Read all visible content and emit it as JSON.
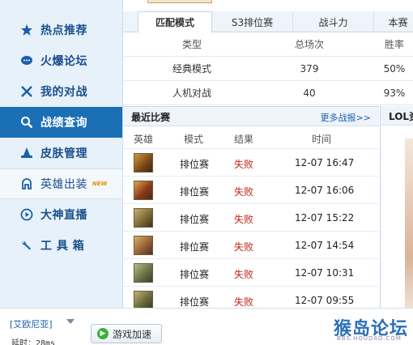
{
  "sidebar": {
    "items": [
      {
        "label": "热点推荐",
        "icon": "star-icon"
      },
      {
        "label": "火爆论坛",
        "icon": "chat-icon"
      },
      {
        "label": "我的对战",
        "icon": "crossed-swords-icon"
      },
      {
        "label": "战绩查询",
        "icon": "search-icon"
      },
      {
        "label": "皮肤管理",
        "icon": "wizard-hat-icon"
      },
      {
        "label": "英雄出装",
        "icon": "helmet-icon",
        "badge": "NEW"
      },
      {
        "label": "大神直播",
        "icon": "play-icon"
      },
      {
        "label": "工 具 箱",
        "icon": "wrench-icon"
      }
    ],
    "active_label": "战绩查询"
  },
  "tabs": [
    "匹配模式",
    "S3排位赛",
    "战斗力",
    "本赛"
  ],
  "stats_table": {
    "headers": [
      "类型",
      "总场次",
      "胜率"
    ],
    "rows": [
      [
        "经典模式",
        "379",
        "50%"
      ],
      [
        "人机对战",
        "40",
        "93%"
      ]
    ]
  },
  "recent": {
    "title": "最近比赛",
    "more_link": "更多战报>>",
    "headers": [
      "英雄",
      "模式",
      "结果",
      "时间"
    ],
    "rows": [
      {
        "mode": "排位赛",
        "result": "失败",
        "time": "12-07 16:47"
      },
      {
        "mode": "排位赛",
        "result": "失败",
        "time": "12-07 16:06"
      },
      {
        "mode": "排位赛",
        "result": "失败",
        "time": "12-07 15:22"
      },
      {
        "mode": "排位赛",
        "result": "失败",
        "time": "12-07 14:54"
      },
      {
        "mode": "排位赛",
        "result": "失败",
        "time": "12-07 10:31"
      },
      {
        "mode": "排位赛",
        "result": "失败",
        "time": "12-07 09:55"
      }
    ]
  },
  "side_panel": {
    "title": "LOL资"
  },
  "bottom": {
    "server": "[艾欧尼亚]",
    "latency": "延时：28ms",
    "accel_button": "游戏加速",
    "watermark": "猴岛论坛",
    "watermark_url": "BBS.HOUDAO.COM"
  },
  "colors": {
    "accent": "#1a6fb5",
    "loss": "#c0281b",
    "link": "#1a5fa8"
  }
}
